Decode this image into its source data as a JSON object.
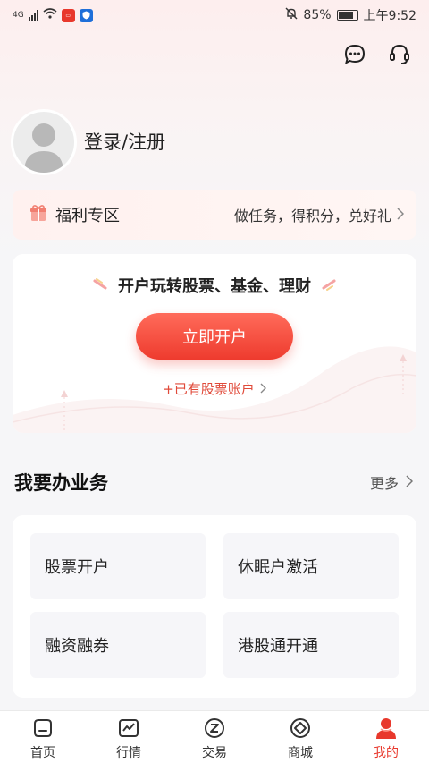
{
  "status_bar": {
    "network": "4G",
    "battery_pct": "85%",
    "time": "上午9:52",
    "battery_level": 0.85
  },
  "profile": {
    "login_text": "登录/注册"
  },
  "welfare": {
    "title": "福利专区",
    "subtitle": "做任务，得积分，兑好礼"
  },
  "open_account": {
    "headline": "开户玩转股票、基金、理财",
    "button_label": "立即开户",
    "existing_link": "+已有股票账户"
  },
  "business": {
    "title": "我要办业务",
    "more_label": "更多",
    "items": [
      {
        "label": "股票开户"
      },
      {
        "label": "休眠户激活"
      },
      {
        "label": "融资融券"
      },
      {
        "label": "港股通开通"
      }
    ]
  },
  "tabbar": {
    "items": [
      {
        "label": "首页",
        "icon": "home-icon"
      },
      {
        "label": "行情",
        "icon": "chart-icon"
      },
      {
        "label": "交易",
        "icon": "trade-icon"
      },
      {
        "label": "商城",
        "icon": "mall-icon"
      },
      {
        "label": "我的",
        "icon": "person-icon"
      }
    ],
    "active_index": 4
  },
  "colors": {
    "accent": "#e8382c",
    "button_gradient_top": "#ff6b5a",
    "button_gradient_bottom": "#ee3b2e"
  }
}
